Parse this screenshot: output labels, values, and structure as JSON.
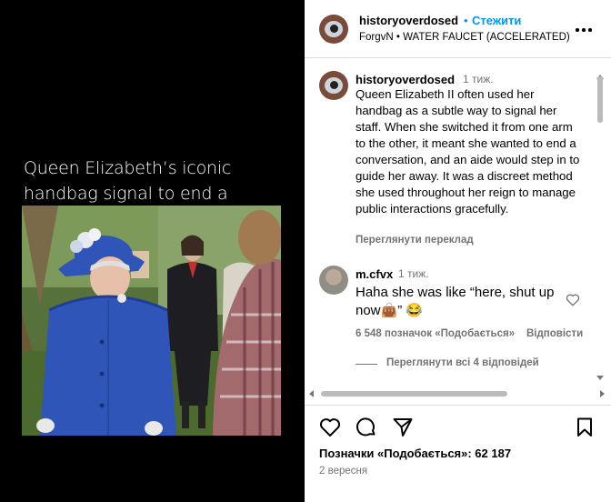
{
  "media": {
    "caption": "Queen Elizabeth’s iconic handbag signal to end a conversation"
  },
  "post_header": {
    "username": "historyoverdosed",
    "separator": "•",
    "follow_label": "Стежити",
    "audio": "ForgvN • WATER FAUCET (ACCELERATED)",
    "more_icon": "more-horizontal-icon"
  },
  "caption_comment": {
    "username": "historyoverdosed",
    "time": "1 тиж.",
    "text": "Queen Elizabeth II often used her handbag as a subtle way to signal her staff. When she switched it from one arm to the other, it meant she wanted to end a conversation, and an aide would step in to guide her away. It was a discreet method she used throughout her reign to manage public interactions gracefully.",
    "translate_label": "Переглянути переклад"
  },
  "comment": {
    "username": "m.cfvx",
    "time": "1 тиж.",
    "text": "Haha she was like “here, shut up now👜” 😂",
    "likes": "6 548 позначок «Подобається»",
    "reply_label": "Відповісти",
    "view_replies": "Переглянути всі 4 відповідей"
  },
  "actions": {
    "likes_text": "Позначки «Подобається»: 62 187",
    "date": "2 вересня"
  },
  "colors": {
    "accent": "#0095f6",
    "muted": "#737373",
    "coat": "#2f55b8"
  }
}
